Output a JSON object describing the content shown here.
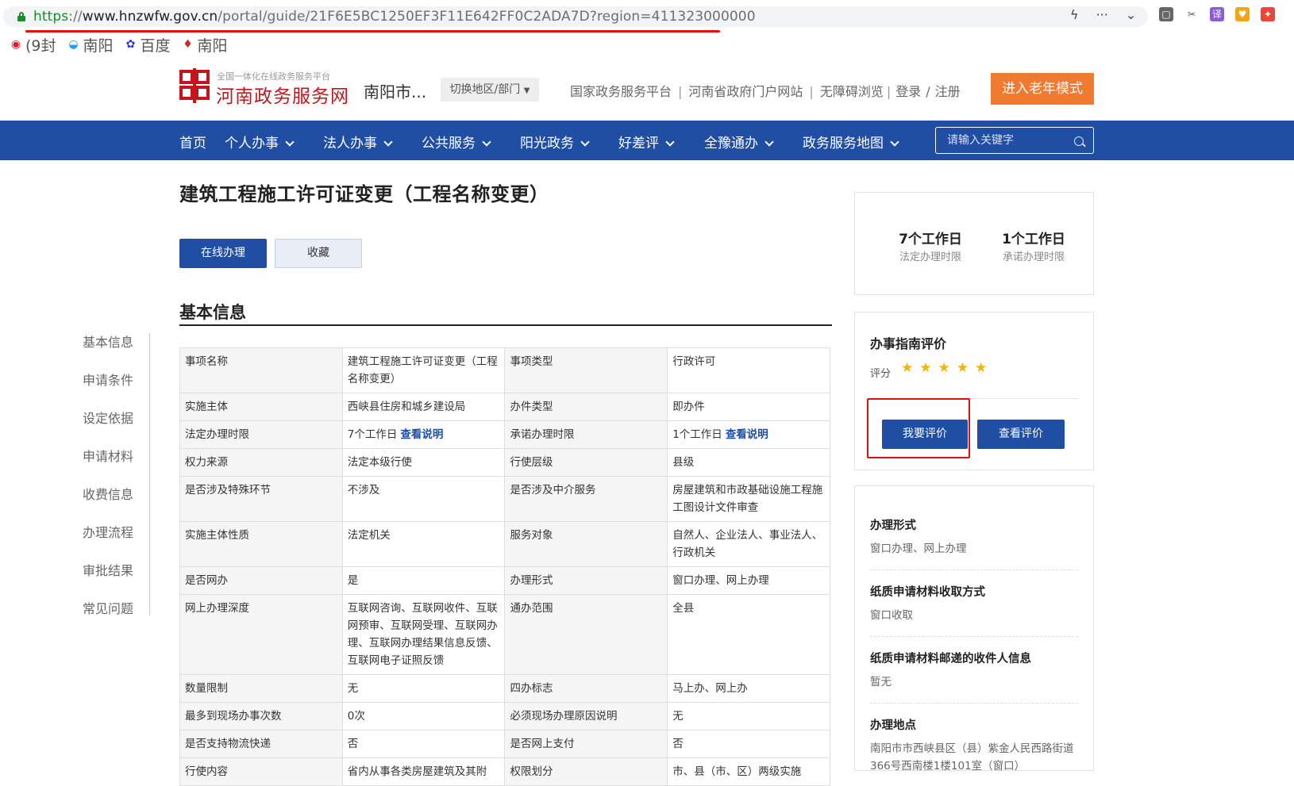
{
  "browser": {
    "url_scheme": "https",
    "url_sep": "://",
    "url_host": "www.hnzwfw.gov.cn",
    "url_path": "/portal/guide/21F6E5BC1250EF3F11E642FF0C2ADA7D?region=411323000000",
    "bookmarks": [
      {
        "icon": "weibo-icon",
        "label": "(9封"
      },
      {
        "icon": "nanyang-icon",
        "label": "南阳"
      },
      {
        "icon": "baidu-icon",
        "label": "百度"
      },
      {
        "icon": "nanyang-red-icon",
        "label": "南阳"
      }
    ]
  },
  "header": {
    "logo_sub": "全国一体化在线政务服务平台",
    "logo_title": "河南政务服务网",
    "city": "南阳市...",
    "switch_label": "切换地区/部门",
    "links": [
      "国家政务服务平台",
      "河南省政府门户网站",
      "无障碍浏览"
    ],
    "login": "登录",
    "register": "注册",
    "elder_mode": "进入老年模式"
  },
  "nav": {
    "items": [
      "首页",
      "个人办事",
      "法人办事",
      "公共服务",
      "阳光政务",
      "好差评",
      "全豫通办",
      "政务服务地图"
    ],
    "search_placeholder": "请输入关键字"
  },
  "main": {
    "title": "建筑工程施工许可证变更（工程名称变更）",
    "btn_online": "在线办理",
    "btn_fav": "收藏",
    "section_title": "基本信息"
  },
  "side_menu": [
    "基本信息",
    "申请条件",
    "设定依据",
    "申请材料",
    "收费信息",
    "办理流程",
    "审批结果",
    "常见问题"
  ],
  "table": {
    "link_label": "查看说明",
    "rows": [
      [
        "事项名称",
        "建筑工程施工许可证变更（工程名称变更）",
        "事项类型",
        "行政许可"
      ],
      [
        "实施主体",
        "西峡县住房和城乡建设局",
        "办件类型",
        "即办件"
      ],
      [
        "法定办理时限",
        "7个工作日",
        "承诺办理时限",
        "1个工作日"
      ],
      [
        "权力来源",
        "法定本级行使",
        "行使层级",
        "县级"
      ],
      [
        "是否涉及特殊环节",
        "不涉及",
        "是否涉及中介服务",
        "房屋建筑和市政基础设施工程施工图设计文件审查"
      ],
      [
        "实施主体性质",
        "法定机关",
        "服务对象",
        "自然人、企业法人、事业法人、行政机关"
      ],
      [
        "是否网办",
        "是",
        "办理形式",
        "窗口办理、网上办理"
      ],
      [
        "网上办理深度",
        "互联网咨询、互联网收件、互联网预审、互联网受理、互联网办理、互联网办理结果信息反馈、互联网电子证照反馈",
        "通办范围",
        "全县"
      ],
      [
        "数量限制",
        "无",
        "四办标志",
        "马上办、网上办"
      ],
      [
        "最多到现场办事次数",
        "0次",
        "必须现场办理原因说明",
        "无"
      ],
      [
        "是否支持物流快递",
        "否",
        "是否网上支付",
        "否"
      ],
      [
        "行使内容",
        "省内从事各类房屋建筑及其附",
        "权限划分",
        "市、县（市、区）两级实施"
      ]
    ]
  },
  "right": {
    "legal_time": "7个工作日",
    "legal_time_label": "法定办理时限",
    "promise_time": "1个工作日",
    "promise_time_label": "承诺办理时限",
    "rating_title": "办事指南评价",
    "rating_label": "评分",
    "rating_stars": 5,
    "btn_rate": "我要评价",
    "btn_view": "查看评价",
    "details": [
      {
        "title": "办理形式",
        "value": "窗口办理、网上办理"
      },
      {
        "title": "纸质申请材料收取方式",
        "value": "窗口收取"
      },
      {
        "title": "纸质申请材料邮递的收件人信息",
        "value": "暂无"
      },
      {
        "title": "办理地点",
        "value": "南阳市市西峡县区（县）紫金人民西路街道366号西南楼1楼101室（窗口）"
      }
    ]
  },
  "colors": {
    "nav_blue": "#1f4ea3",
    "brand_red": "#c4151c",
    "elder_orange": "#f17a31",
    "star": "#f5b400",
    "highlight_red": "#e01010"
  }
}
